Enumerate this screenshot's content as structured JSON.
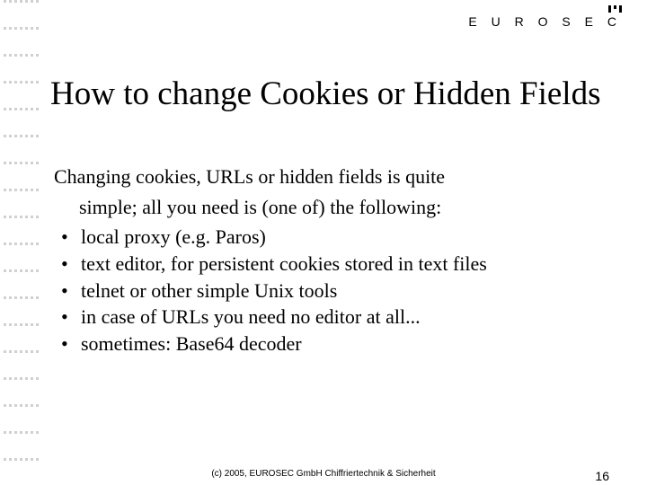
{
  "brand": "E U R O S E C",
  "title": "How to change Cookies or Hidden Fields",
  "intro_line1": "Changing cookies, URLs or hidden fields is quite",
  "intro_line2": "simple; all you need is (one of) the following:",
  "bullets": {
    "b0": "local proxy (e.g. Paros)",
    "b1": "text editor, for persistent cookies stored in text files",
    "b2": "telnet or other simple Unix tools",
    "b3": "in case of URLs you need no editor at all...",
    "b4": "sometimes: Base64 decoder"
  },
  "footer": {
    "copyright": "(c) 2005, EUROSEC GmbH Chiffriertechnik & Sicherheit",
    "page": "16"
  }
}
